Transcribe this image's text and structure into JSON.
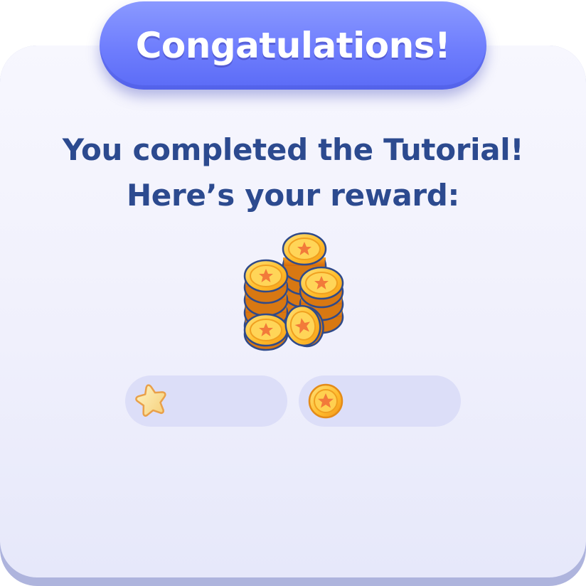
{
  "dialog": {
    "title": "Congatulations!",
    "message_line1": "You completed the Tutorial!",
    "message_line2": "Here’s your reward:"
  },
  "reward": {
    "icon": "coin-stack-icon",
    "stars": {
      "icon": "star-icon",
      "amount": ""
    },
    "coins": {
      "icon": "coin-icon",
      "amount": ""
    }
  },
  "colors": {
    "banner": "#6e7dfd",
    "text": "#2c4a8f",
    "panel": "#f0f0fc",
    "pill": "#dcdef8",
    "coin_gold": "#f9b52a",
    "coin_star": "#f27a3a"
  }
}
